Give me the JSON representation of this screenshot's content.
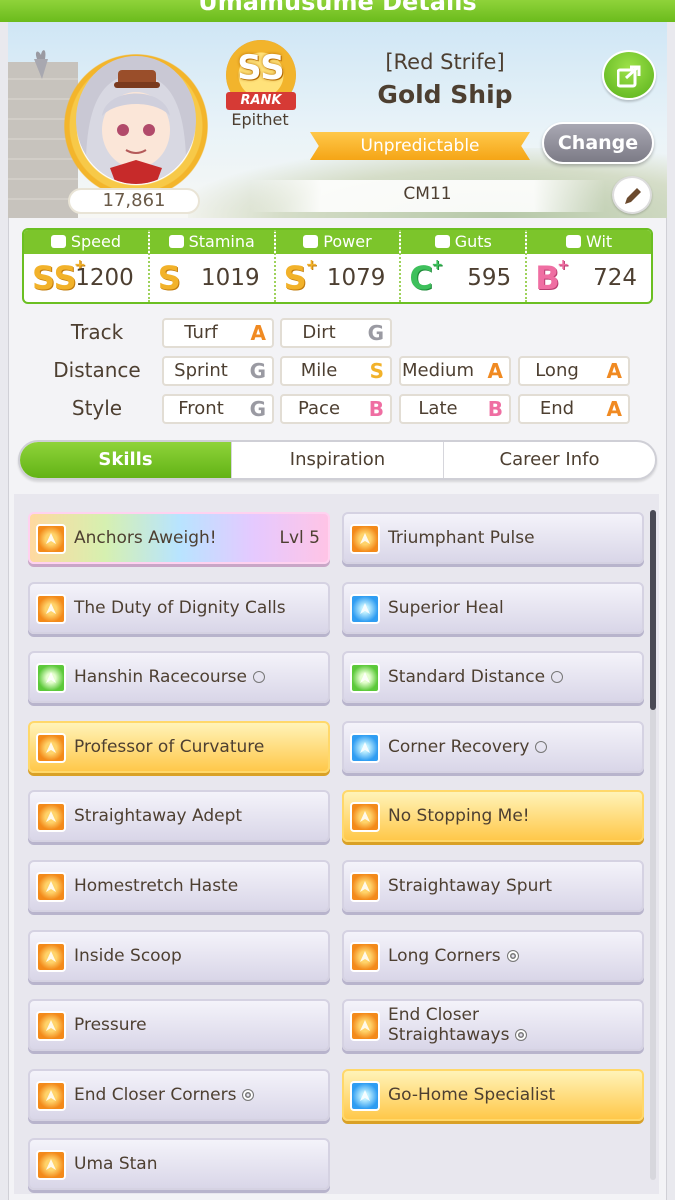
{
  "window": {
    "title": "Umamusume Details"
  },
  "character": {
    "epithet_title": "[Red Strife]",
    "name": "Gold Ship",
    "fans": "17,861",
    "rank": "SS",
    "rank_ribbon": "RANK",
    "epithet_label": "Epithet",
    "tagline": "Unpredictable",
    "trainer": "CM11"
  },
  "buttons": {
    "change": "Change"
  },
  "stats": [
    {
      "label": "Speed",
      "grade": "SS",
      "plus": "+",
      "value": "1200",
      "icon": "shoe-icon"
    },
    {
      "label": "Stamina",
      "grade": "S",
      "plus": "",
      "value": "1019",
      "icon": "heart-icon"
    },
    {
      "label": "Power",
      "grade": "S",
      "plus": "+",
      "value": "1079",
      "icon": "flex-icon"
    },
    {
      "label": "Guts",
      "grade": "C",
      "plus": "+",
      "value": "595",
      "icon": "flame-icon"
    },
    {
      "label": "Wit",
      "grade": "B",
      "plus": "+",
      "value": "724",
      "icon": "cap-icon"
    }
  ],
  "aptitude": {
    "rows": [
      {
        "label": "Track",
        "cells": [
          {
            "name": "Turf",
            "rank": "A"
          },
          {
            "name": "Dirt",
            "rank": "G"
          }
        ]
      },
      {
        "label": "Distance",
        "cells": [
          {
            "name": "Sprint",
            "rank": "G"
          },
          {
            "name": "Mile",
            "rank": "S"
          },
          {
            "name": "Medium",
            "rank": "A"
          },
          {
            "name": "Long",
            "rank": "A"
          }
        ]
      },
      {
        "label": "Style",
        "cells": [
          {
            "name": "Front",
            "rank": "G"
          },
          {
            "name": "Pace",
            "rank": "B"
          },
          {
            "name": "Late",
            "rank": "B"
          },
          {
            "name": "End",
            "rank": "A"
          }
        ]
      }
    ]
  },
  "tabs": [
    {
      "label": "Skills",
      "active": true
    },
    {
      "label": "Inspiration",
      "active": false
    },
    {
      "label": "Career Info",
      "active": false
    }
  ],
  "skills": [
    {
      "name": "Anchors Aweigh!",
      "level": "Lvl  5",
      "style": "rainbow",
      "icon": "orange"
    },
    {
      "name": "Triumphant Pulse",
      "style": "normal",
      "icon": "orange"
    },
    {
      "name": "The Duty of Dignity Calls",
      "style": "normal",
      "icon": "orange"
    },
    {
      "name": "Superior Heal",
      "style": "normal",
      "icon": "blue"
    },
    {
      "name": "Hanshin Racecourse",
      "mark": "○",
      "style": "normal",
      "icon": "green"
    },
    {
      "name": "Standard Distance",
      "mark": "○",
      "style": "normal",
      "icon": "green"
    },
    {
      "name": "Professor of Curvature",
      "style": "gold",
      "icon": "orange"
    },
    {
      "name": "Corner Recovery",
      "mark": "○",
      "style": "normal",
      "icon": "blue"
    },
    {
      "name": "Straightaway Adept",
      "style": "normal",
      "icon": "orange"
    },
    {
      "name": "No Stopping Me!",
      "style": "gold",
      "icon": "orange"
    },
    {
      "name": "Homestretch Haste",
      "style": "normal",
      "icon": "orange"
    },
    {
      "name": "Straightaway Spurt",
      "style": "normal",
      "icon": "orange"
    },
    {
      "name": "Inside Scoop",
      "style": "normal",
      "icon": "orange"
    },
    {
      "name": "Long Corners",
      "mark": "◎",
      "style": "normal",
      "icon": "orange"
    },
    {
      "name": "Pressure",
      "style": "normal",
      "icon": "orange"
    },
    {
      "name": "End Closer Straightaways",
      "mark": "◎",
      "style": "normal",
      "icon": "orange"
    },
    {
      "name": "End Closer Corners",
      "mark": "◎",
      "style": "normal",
      "icon": "orange"
    },
    {
      "name": "Go-Home Specialist",
      "style": "gold",
      "icon": "blue"
    },
    {
      "name": "Uma Stan",
      "style": "normal",
      "icon": "orange"
    }
  ]
}
